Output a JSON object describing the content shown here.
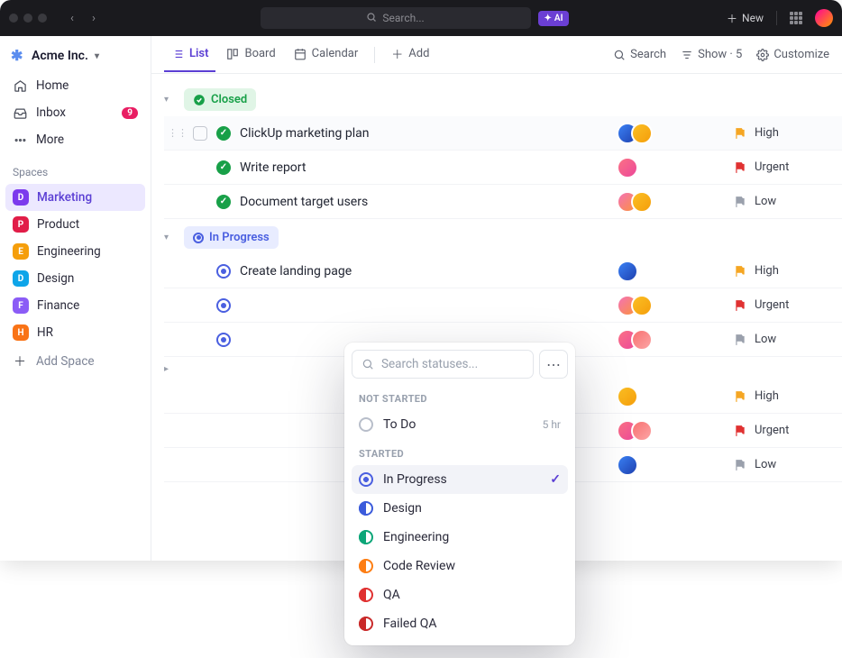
{
  "topbar": {
    "search_placeholder": "Search...",
    "ai_label": "AI",
    "new_label": "New"
  },
  "sidebar": {
    "workspace": "Acme Inc.",
    "items": [
      {
        "label": "Home"
      },
      {
        "label": "Inbox",
        "badge": "9"
      },
      {
        "label": "More"
      }
    ],
    "spaces_heading": "Spaces",
    "spaces": [
      {
        "initial": "D",
        "label": "Marketing",
        "color": "#7c3aed",
        "active": true
      },
      {
        "initial": "P",
        "label": "Product",
        "color": "#e11d48"
      },
      {
        "initial": "E",
        "label": "Engineering",
        "color": "#f59e0b"
      },
      {
        "initial": "D",
        "label": "Design",
        "color": "#0ea5e9"
      },
      {
        "initial": "F",
        "label": "Finance",
        "color": "#8b5cf6"
      },
      {
        "initial": "H",
        "label": "HR",
        "color": "#f97316"
      }
    ],
    "add_space": "Add Space"
  },
  "viewbar": {
    "tabs": [
      {
        "label": "List",
        "active": true
      },
      {
        "label": "Board"
      },
      {
        "label": "Calendar"
      }
    ],
    "add": "Add",
    "search": "Search",
    "show": "Show · 5",
    "customize": "Customize"
  },
  "groups": [
    {
      "status": "Closed",
      "kind": "closed",
      "tasks": [
        {
          "name": "ClickUp marketing plan",
          "avatars": [
            "c1",
            "c2"
          ],
          "priority": "High",
          "pcolor": "#f5a623",
          "hover": true,
          "indent": 0
        },
        {
          "name": "Write report",
          "avatars": [
            "c3"
          ],
          "priority": "Urgent",
          "pcolor": "#e03131",
          "indent": 0
        },
        {
          "name": "Document target users",
          "avatars": [
            "c5",
            "c2"
          ],
          "priority": "Low",
          "pcolor": "#9aa0ac",
          "indent": 0
        }
      ]
    },
    {
      "status": "In Progress",
      "kind": "inprog",
      "tasks": [
        {
          "name": "Create landing page",
          "avatars": [
            "c1"
          ],
          "priority": "High",
          "pcolor": "#f5a623",
          "indent": 0
        },
        {
          "name": "",
          "avatars": [
            "c5",
            "c2"
          ],
          "priority": "Urgent",
          "pcolor": "#e03131",
          "indent": 0
        },
        {
          "name": "",
          "avatars": [
            "c3",
            "c6"
          ],
          "priority": "Low",
          "pcolor": "#9aa0ac",
          "indent": 0
        }
      ]
    },
    {
      "status": "",
      "kind": "hidden",
      "tasks": [
        {
          "name": "",
          "avatars": [
            "c2"
          ],
          "priority": "High",
          "pcolor": "#f5a623",
          "indent": 0
        },
        {
          "name": "",
          "avatars": [
            "c3",
            "c6"
          ],
          "priority": "Urgent",
          "pcolor": "#e03131",
          "indent": 0
        },
        {
          "name": "",
          "avatars": [
            "c1"
          ],
          "priority": "Low",
          "pcolor": "#9aa0ac",
          "indent": 0
        }
      ]
    }
  ],
  "status_picker": {
    "search_placeholder": "Search statuses...",
    "sections": [
      {
        "heading": "NOT STARTED",
        "items": [
          {
            "label": "To Do",
            "icon": "todo",
            "trail": "5 hr"
          }
        ]
      },
      {
        "heading": "STARTED",
        "items": [
          {
            "label": "In Progress",
            "icon": "prog",
            "selected": true
          },
          {
            "label": "Design",
            "icon": "design"
          },
          {
            "label": "Engineering",
            "icon": "eng"
          },
          {
            "label": "Code Review",
            "icon": "code"
          },
          {
            "label": "QA",
            "icon": "qa"
          },
          {
            "label": "Failed QA",
            "icon": "fqa"
          }
        ]
      }
    ]
  }
}
